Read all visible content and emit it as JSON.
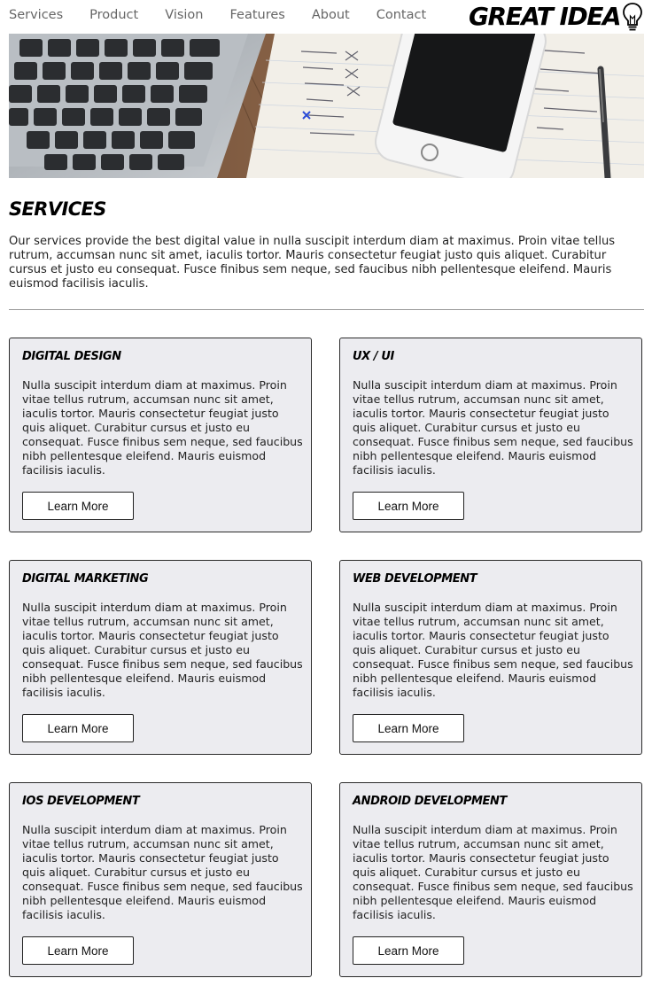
{
  "nav": {
    "items": [
      "Services",
      "Product",
      "Vision",
      "Features",
      "About",
      "Contact"
    ]
  },
  "logo": {
    "text": "GREAT IDEA",
    "icon": "lightbulb-icon"
  },
  "hero": {
    "image": "desk with laptop keyboard, notebook, smartphone and pen"
  },
  "services": {
    "title": "SERVICES",
    "intro": "Our services provide the best digital value in nulla suscipit interdum diam at maximus. Proin vitae tellus rutrum, accumsan nunc sit amet, iaculis tortor. Mauris consectetur feugiat justo quis aliquet. Curabitur cursus et justo eu consequat. Fusce finibus sem neque, sed faucibus nibh pellentesque eleifend. Mauris euismod facilisis iaculis."
  },
  "cards": [
    {
      "title": "DIGITAL DESIGN",
      "body": "Nulla suscipit interdum diam at maximus. Proin vitae tellus rutrum, accumsan nunc sit amet, iaculis tortor. Mauris consectetur feugiat justo quis aliquet. Curabitur cursus et justo eu consequat. Fusce finibus sem neque, sed faucibus nibh pellentesque eleifend. Mauris euismod facilisis iaculis.",
      "button": "Learn More"
    },
    {
      "title": "UX / UI",
      "body": "Nulla suscipit interdum diam at maximus. Proin vitae tellus rutrum, accumsan nunc sit amet, iaculis tortor. Mauris consectetur feugiat justo quis aliquet. Curabitur cursus et justo eu consequat. Fusce finibus sem neque, sed faucibus nibh pellentesque eleifend. Mauris euismod facilisis iaculis.",
      "button": "Learn More"
    },
    {
      "title": "DIGITAL MARKETING",
      "body": "Nulla suscipit interdum diam at maximus. Proin vitae tellus rutrum, accumsan nunc sit amet, iaculis tortor. Mauris consectetur feugiat justo quis aliquet. Curabitur cursus et justo eu consequat. Fusce finibus sem neque, sed faucibus nibh pellentesque eleifend. Mauris euismod facilisis iaculis.",
      "button": "Learn More"
    },
    {
      "title": "WEB DEVELOPMENT",
      "body": "Nulla suscipit interdum diam at maximus. Proin vitae tellus rutrum, accumsan nunc sit amet, iaculis tortor. Mauris consectetur feugiat justo quis aliquet. Curabitur cursus et justo eu consequat. Fusce finibus sem neque, sed faucibus nibh pellentesque eleifend. Mauris euismod facilisis iaculis.",
      "button": "Learn More"
    },
    {
      "title": "IOS DEVELOPMENT",
      "body": "Nulla suscipit interdum diam at maximus. Proin vitae tellus rutrum, accumsan nunc sit amet, iaculis tortor. Mauris consectetur feugiat justo quis aliquet. Curabitur cursus et justo eu consequat. Fusce finibus sem neque, sed faucibus nibh pellentesque eleifend. Mauris euismod facilisis iaculis.",
      "button": "Learn More"
    },
    {
      "title": "ANDROID DEVELOPMENT",
      "body": "Nulla suscipit interdum diam at maximus. Proin vitae tellus rutrum, accumsan nunc sit amet, iaculis tortor. Mauris consectetur feugiat justo quis aliquet. Curabitur cursus et justo eu consequat. Fusce finibus sem neque, sed faucibus nibh pellentesque eleifend. Mauris euismod facilisis iaculis.",
      "button": "Learn More"
    }
  ],
  "colors": {
    "card_bg": "#ececf0",
    "card_border": "#2a2a2a",
    "nav_text": "#666666",
    "divider": "#999999"
  }
}
